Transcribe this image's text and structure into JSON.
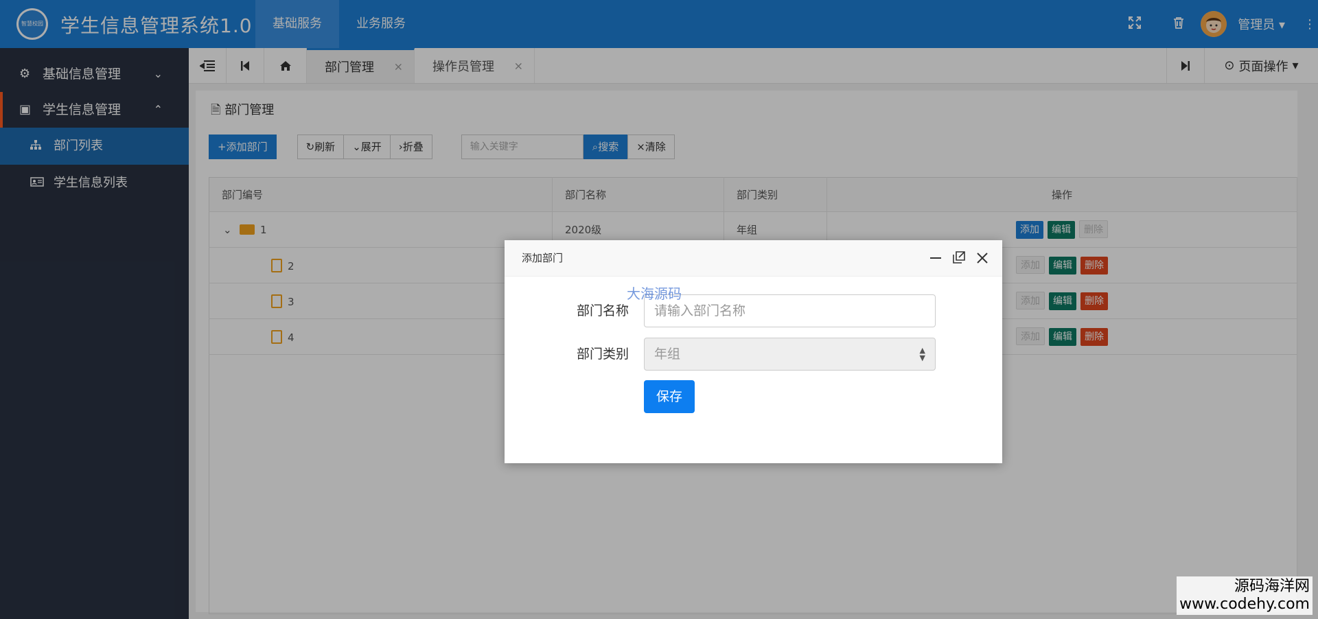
{
  "header": {
    "logo_text": "智慧校园",
    "title": "学生信息管理系统1.0",
    "nav": [
      "基础服务",
      "业务服务"
    ],
    "user": "管理员"
  },
  "sidebar": {
    "groups": [
      {
        "label": "基础信息管理"
      },
      {
        "label": "学生信息管理"
      }
    ],
    "items": [
      "部门列表",
      "学生信息列表"
    ]
  },
  "tabbar": {
    "tabs": [
      "部门管理",
      "操作员管理"
    ],
    "page_ops": "页面操作"
  },
  "content": {
    "panel_title": "部门管理",
    "toolbar": {
      "add": "添加部门",
      "refresh": "刷新",
      "expand": "展开",
      "collapse": "折叠",
      "keyword_placeholder": "输入关键字",
      "search": "搜索",
      "clear": "清除"
    },
    "table": {
      "headers": [
        "部门编号",
        "部门名称",
        "部门类别",
        "操作"
      ],
      "rows": [
        {
          "id": "1",
          "name": "2020级",
          "category": "年组"
        },
        {
          "id": "2",
          "name": "",
          "category": ""
        },
        {
          "id": "3",
          "name": "",
          "category": ""
        },
        {
          "id": "4",
          "name": "",
          "category": ""
        }
      ],
      "ops": {
        "add": "添加",
        "edit": "编辑",
        "delete": "删除"
      }
    }
  },
  "modal": {
    "title": "添加部门",
    "name_label": "部门名称",
    "name_placeholder": "请输入部门名称",
    "category_label": "部门类别",
    "category_value": "年组",
    "save": "保存",
    "watermark": "大海源码"
  },
  "watermark": {
    "line1": "源码海洋网",
    "line2": "www.codehy.com"
  }
}
